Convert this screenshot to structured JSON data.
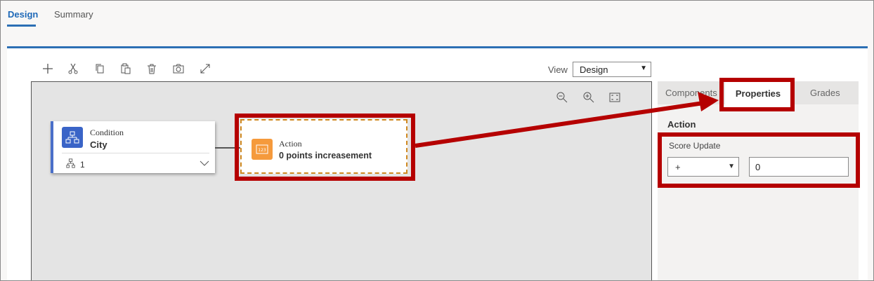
{
  "tabs": [
    {
      "label": "Design",
      "active": true
    },
    {
      "label": "Summary",
      "active": false
    }
  ],
  "toolbar": {
    "icons": [
      "add-icon",
      "cut-icon",
      "copy-icon",
      "paste-icon",
      "delete-icon",
      "snapshot-icon",
      "expand-icon"
    ],
    "view_label": "View",
    "view_value": "Design"
  },
  "canvas": {
    "zoom_icons": [
      "zoom-out-icon",
      "zoom-in-icon",
      "fit-screen-icon"
    ],
    "condition_node": {
      "title": "Condition",
      "subtitle": "City",
      "branch_count": "1"
    },
    "action_node": {
      "title": "Action",
      "subtitle": "0 points increasement"
    }
  },
  "panel": {
    "tabs": [
      "Components",
      "Properties",
      "Grades"
    ],
    "active_tab": "Properties",
    "section_title": "Action",
    "score_update_label": "Score Update",
    "operator_value": "+",
    "score_value": "0"
  },
  "colors": {
    "accent_blue": "#2c6fb4",
    "annotation_red": "#b50000",
    "condition_icon": "#3a64c7",
    "action_icon": "#f59a3c"
  }
}
